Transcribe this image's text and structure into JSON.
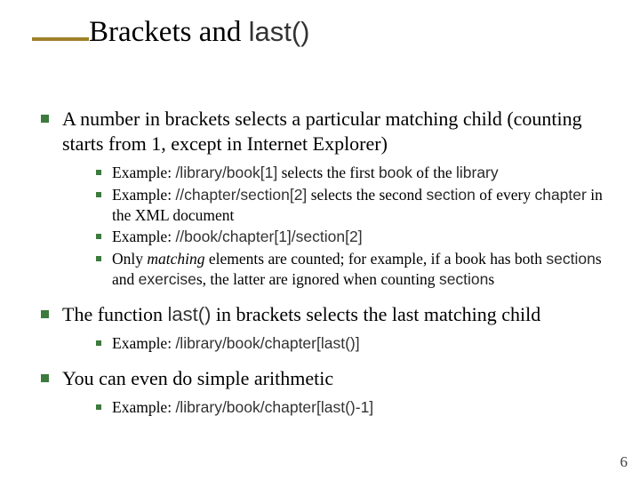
{
  "title": {
    "part1": "Brackets and ",
    "code": "last()"
  },
  "bullets": {
    "b1": {
      "text_a": "A number in brackets selects a particular matching child (counting starts from 1, except in Internet Explorer)",
      "sub": {
        "s1_a": "Example:  ",
        "s1_code1": "/library/book[1]",
        "s1_b": " selects the first ",
        "s1_code2": "book",
        "s1_c": " of the ",
        "s1_code3": "library",
        "s2_a": "Example:  ",
        "s2_code1": "//chapter/section[2]",
        "s2_b": " selects the second ",
        "s2_code2": "section",
        "s2_c": " of every ",
        "s2_code3": "chapter",
        "s2_d": " in the XML document",
        "s3_a": "Example:  ",
        "s3_code1": "//book/chapter[1]/section[2]",
        "s4_a": "Only ",
        "s4_ital": "matching",
        "s4_b": " elements are counted; for example, if a book has both ",
        "s4_code1": "section",
        "s4_c": "s and ",
        "s4_code2": "exercise",
        "s4_d": "s, the latter are ignored when counting ",
        "s4_code3": "section",
        "s4_e": "s"
      }
    },
    "b2": {
      "text_a": "The function ",
      "code1": "last()",
      "text_b": " in brackets selects the last matching child",
      "sub": {
        "s1_a": "Example:  ",
        "s1_code1": "/library/book/chapter[last()]"
      }
    },
    "b3": {
      "text_a": "You can even do simple arithmetic",
      "sub": {
        "s1_a": "Example:  ",
        "s1_code1": "/library/book/chapter[last()-1]"
      }
    }
  },
  "page_number": "6"
}
